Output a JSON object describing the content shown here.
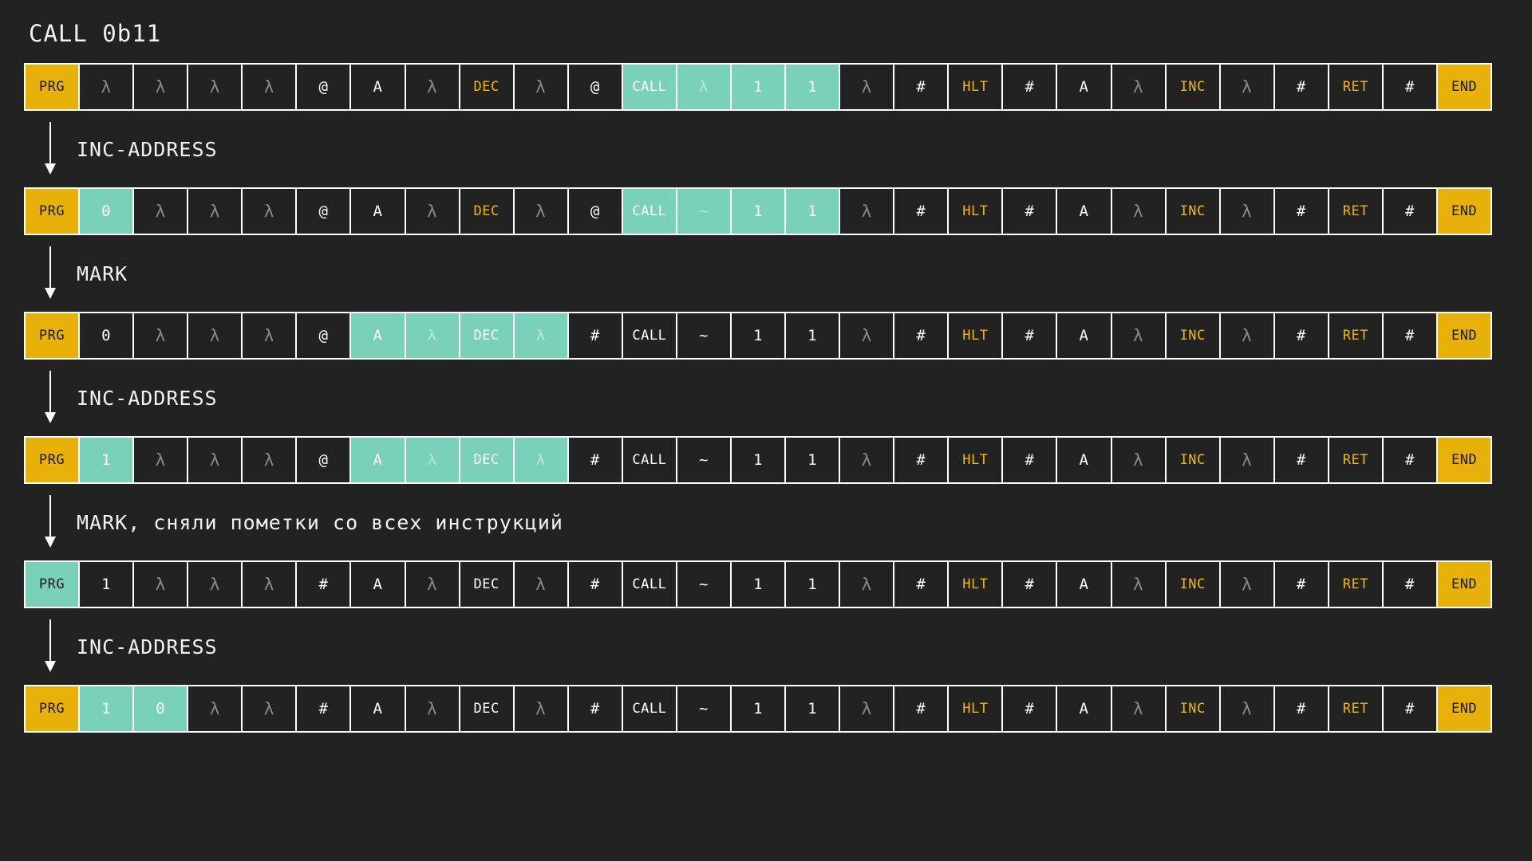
{
  "title": "CALL 0b11",
  "colors": {
    "background": "#222222",
    "cell_background": "#222222",
    "grid": "#ffffff",
    "gold": "#e8b10a",
    "teal": "#79d1b8",
    "op_text": "#f2b705",
    "lambda_text": "#8a8a8a",
    "plain_text": "#ffffff"
  },
  "steps": [
    {
      "label": "INC-ADDRESS",
      "arrow_icon": "arrow-down-icon"
    },
    {
      "label": "MARK",
      "arrow_icon": "arrow-down-icon"
    },
    {
      "label": "INC-ADDRESS",
      "arrow_icon": "arrow-down-icon"
    },
    {
      "label": "MARK, сняли пометки со всех инструкций",
      "arrow_icon": "arrow-down-icon"
    },
    {
      "label": "INC-ADDRESS",
      "arrow_icon": "arrow-down-icon"
    }
  ],
  "tapes": [
    {
      "name": "tape-0",
      "cells": [
        {
          "text": "PRG",
          "style": "prg"
        },
        {
          "text": "λ",
          "style": "lam"
        },
        {
          "text": "λ",
          "style": "lam"
        },
        {
          "text": "λ",
          "style": "lam"
        },
        {
          "text": "λ",
          "style": "lam"
        },
        {
          "text": "@",
          "style": "plain"
        },
        {
          "text": "A",
          "style": "plain"
        },
        {
          "text": "λ",
          "style": "lam"
        },
        {
          "text": "DEC",
          "style": "op small"
        },
        {
          "text": "λ",
          "style": "lam"
        },
        {
          "text": "@",
          "style": "plain"
        },
        {
          "text": "CALL",
          "style": "mark small"
        },
        {
          "text": "λ",
          "style": "mark dim"
        },
        {
          "text": "1",
          "style": "mark"
        },
        {
          "text": "1",
          "style": "mark"
        },
        {
          "text": "λ",
          "style": "lam"
        },
        {
          "text": "#",
          "style": "plain"
        },
        {
          "text": "HLT",
          "style": "op small"
        },
        {
          "text": "#",
          "style": "plain"
        },
        {
          "text": "A",
          "style": "plain"
        },
        {
          "text": "λ",
          "style": "lam"
        },
        {
          "text": "INC",
          "style": "op small"
        },
        {
          "text": "λ",
          "style": "lam"
        },
        {
          "text": "#",
          "style": "plain"
        },
        {
          "text": "RET",
          "style": "op small"
        },
        {
          "text": "#",
          "style": "plain"
        },
        {
          "text": "END",
          "style": "end"
        }
      ]
    },
    {
      "name": "tape-1",
      "cells": [
        {
          "text": "PRG",
          "style": "prg"
        },
        {
          "text": "0",
          "style": "mark"
        },
        {
          "text": "λ",
          "style": "lam"
        },
        {
          "text": "λ",
          "style": "lam"
        },
        {
          "text": "λ",
          "style": "lam"
        },
        {
          "text": "@",
          "style": "plain"
        },
        {
          "text": "A",
          "style": "plain"
        },
        {
          "text": "λ",
          "style": "lam"
        },
        {
          "text": "DEC",
          "style": "op small"
        },
        {
          "text": "λ",
          "style": "lam"
        },
        {
          "text": "@",
          "style": "plain"
        },
        {
          "text": "CALL",
          "style": "mark small"
        },
        {
          "text": "~",
          "style": "mark dim"
        },
        {
          "text": "1",
          "style": "mark"
        },
        {
          "text": "1",
          "style": "mark"
        },
        {
          "text": "λ",
          "style": "lam"
        },
        {
          "text": "#",
          "style": "plain"
        },
        {
          "text": "HLT",
          "style": "op small"
        },
        {
          "text": "#",
          "style": "plain"
        },
        {
          "text": "A",
          "style": "plain"
        },
        {
          "text": "λ",
          "style": "lam"
        },
        {
          "text": "INC",
          "style": "op small"
        },
        {
          "text": "λ",
          "style": "lam"
        },
        {
          "text": "#",
          "style": "plain"
        },
        {
          "text": "RET",
          "style": "op small"
        },
        {
          "text": "#",
          "style": "plain"
        },
        {
          "text": "END",
          "style": "end"
        }
      ]
    },
    {
      "name": "tape-2",
      "cells": [
        {
          "text": "PRG",
          "style": "prg"
        },
        {
          "text": "0",
          "style": "plain"
        },
        {
          "text": "λ",
          "style": "lam"
        },
        {
          "text": "λ",
          "style": "lam"
        },
        {
          "text": "λ",
          "style": "lam"
        },
        {
          "text": "@",
          "style": "plain"
        },
        {
          "text": "A",
          "style": "mark"
        },
        {
          "text": "λ",
          "style": "mark dim"
        },
        {
          "text": "DEC",
          "style": "mark small"
        },
        {
          "text": "λ",
          "style": "mark dim"
        },
        {
          "text": "#",
          "style": "plain"
        },
        {
          "text": "CALL",
          "style": "plain small"
        },
        {
          "text": "~",
          "style": "plain"
        },
        {
          "text": "1",
          "style": "plain"
        },
        {
          "text": "1",
          "style": "plain"
        },
        {
          "text": "λ",
          "style": "lam"
        },
        {
          "text": "#",
          "style": "plain"
        },
        {
          "text": "HLT",
          "style": "op small"
        },
        {
          "text": "#",
          "style": "plain"
        },
        {
          "text": "A",
          "style": "plain"
        },
        {
          "text": "λ",
          "style": "lam"
        },
        {
          "text": "INC",
          "style": "op small"
        },
        {
          "text": "λ",
          "style": "lam"
        },
        {
          "text": "#",
          "style": "plain"
        },
        {
          "text": "RET",
          "style": "op small"
        },
        {
          "text": "#",
          "style": "plain"
        },
        {
          "text": "END",
          "style": "end"
        }
      ]
    },
    {
      "name": "tape-3",
      "cells": [
        {
          "text": "PRG",
          "style": "prg"
        },
        {
          "text": "1",
          "style": "mark"
        },
        {
          "text": "λ",
          "style": "lam"
        },
        {
          "text": "λ",
          "style": "lam"
        },
        {
          "text": "λ",
          "style": "lam"
        },
        {
          "text": "@",
          "style": "plain"
        },
        {
          "text": "A",
          "style": "mark"
        },
        {
          "text": "λ",
          "style": "mark dim"
        },
        {
          "text": "DEC",
          "style": "mark small"
        },
        {
          "text": "λ",
          "style": "mark dim"
        },
        {
          "text": "#",
          "style": "plain"
        },
        {
          "text": "CALL",
          "style": "plain small"
        },
        {
          "text": "~",
          "style": "plain"
        },
        {
          "text": "1",
          "style": "plain"
        },
        {
          "text": "1",
          "style": "plain"
        },
        {
          "text": "λ",
          "style": "lam"
        },
        {
          "text": "#",
          "style": "plain"
        },
        {
          "text": "HLT",
          "style": "op small"
        },
        {
          "text": "#",
          "style": "plain"
        },
        {
          "text": "A",
          "style": "plain"
        },
        {
          "text": "λ",
          "style": "lam"
        },
        {
          "text": "INC",
          "style": "op small"
        },
        {
          "text": "λ",
          "style": "lam"
        },
        {
          "text": "#",
          "style": "plain"
        },
        {
          "text": "RET",
          "style": "op small"
        },
        {
          "text": "#",
          "style": "plain"
        },
        {
          "text": "END",
          "style": "end"
        }
      ]
    },
    {
      "name": "tape-4",
      "cells": [
        {
          "text": "PRG",
          "style": "mark prgmark"
        },
        {
          "text": "1",
          "style": "plain"
        },
        {
          "text": "λ",
          "style": "lam"
        },
        {
          "text": "λ",
          "style": "lam"
        },
        {
          "text": "λ",
          "style": "lam"
        },
        {
          "text": "#",
          "style": "plain"
        },
        {
          "text": "A",
          "style": "plain"
        },
        {
          "text": "λ",
          "style": "lam"
        },
        {
          "text": "DEC",
          "style": "plain small"
        },
        {
          "text": "λ",
          "style": "lam"
        },
        {
          "text": "#",
          "style": "plain"
        },
        {
          "text": "CALL",
          "style": "plain small"
        },
        {
          "text": "~",
          "style": "plain"
        },
        {
          "text": "1",
          "style": "plain"
        },
        {
          "text": "1",
          "style": "plain"
        },
        {
          "text": "λ",
          "style": "lam"
        },
        {
          "text": "#",
          "style": "plain"
        },
        {
          "text": "HLT",
          "style": "op small"
        },
        {
          "text": "#",
          "style": "plain"
        },
        {
          "text": "A",
          "style": "plain"
        },
        {
          "text": "λ",
          "style": "lam"
        },
        {
          "text": "INC",
          "style": "op small"
        },
        {
          "text": "λ",
          "style": "lam"
        },
        {
          "text": "#",
          "style": "plain"
        },
        {
          "text": "RET",
          "style": "op small"
        },
        {
          "text": "#",
          "style": "plain"
        },
        {
          "text": "END",
          "style": "end"
        }
      ]
    },
    {
      "name": "tape-5",
      "cells": [
        {
          "text": "PRG",
          "style": "prg"
        },
        {
          "text": "1",
          "style": "mark"
        },
        {
          "text": "0",
          "style": "mark"
        },
        {
          "text": "λ",
          "style": "lam"
        },
        {
          "text": "λ",
          "style": "lam"
        },
        {
          "text": "#",
          "style": "plain"
        },
        {
          "text": "A",
          "style": "plain"
        },
        {
          "text": "λ",
          "style": "lam"
        },
        {
          "text": "DEC",
          "style": "plain small"
        },
        {
          "text": "λ",
          "style": "lam"
        },
        {
          "text": "#",
          "style": "plain"
        },
        {
          "text": "CALL",
          "style": "plain small"
        },
        {
          "text": "~",
          "style": "plain"
        },
        {
          "text": "1",
          "style": "plain"
        },
        {
          "text": "1",
          "style": "plain"
        },
        {
          "text": "λ",
          "style": "lam"
        },
        {
          "text": "#",
          "style": "plain"
        },
        {
          "text": "HLT",
          "style": "op small"
        },
        {
          "text": "#",
          "style": "plain"
        },
        {
          "text": "A",
          "style": "plain"
        },
        {
          "text": "λ",
          "style": "lam"
        },
        {
          "text": "INC",
          "style": "op small"
        },
        {
          "text": "λ",
          "style": "lam"
        },
        {
          "text": "#",
          "style": "plain"
        },
        {
          "text": "RET",
          "style": "op small"
        },
        {
          "text": "#",
          "style": "plain"
        },
        {
          "text": "END",
          "style": "end"
        }
      ]
    }
  ]
}
